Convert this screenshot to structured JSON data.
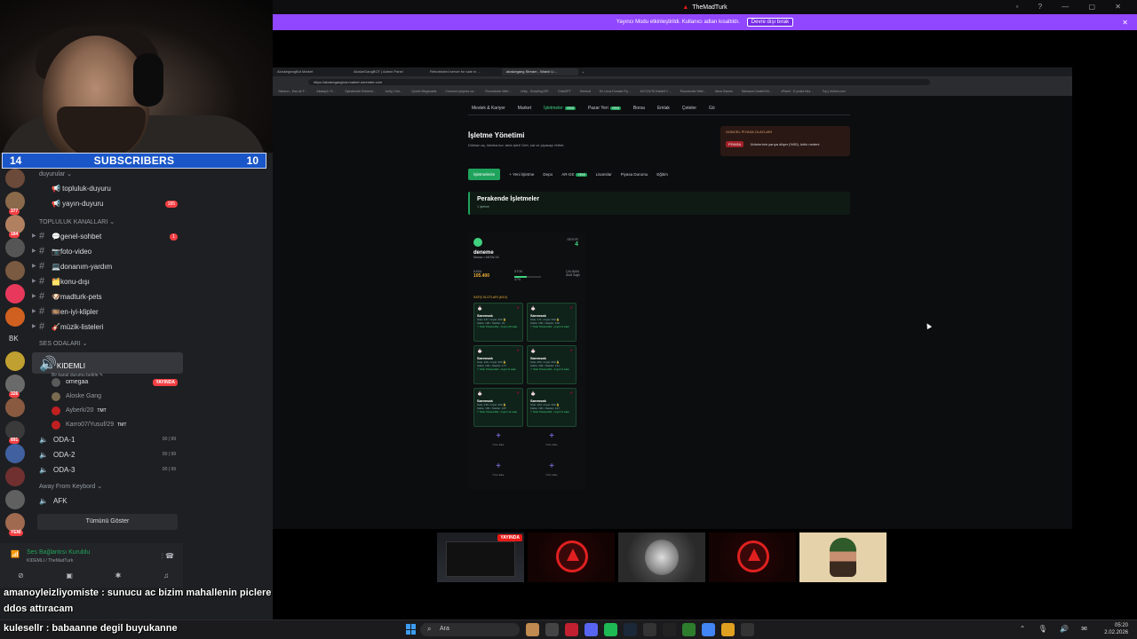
{
  "subscribers_bar": {
    "left": "14",
    "title": "SUBSCRIBERS",
    "right": "10"
  },
  "discord": {
    "guild_badges": [
      "377",
      "184",
      "326",
      "891"
    ],
    "bk_label": "BK",
    "new_label": "YENİ",
    "categories": {
      "duyurular": "duyurular ⌄",
      "topluluk": "TOPLULUK KANALLARI ⌄",
      "ses": "SES ODALARI ⌄",
      "afk": "Away From Keybord ⌄"
    },
    "top_channels": [
      {
        "name": "📢 topluluk-duyuru",
        "count": ""
      },
      {
        "name": "📢 yayın-duyuru",
        "count": "185"
      }
    ],
    "text_channels": [
      {
        "name": "💬genel-sohbet",
        "count": "1"
      },
      {
        "name": "📷foto-video",
        "count": ""
      },
      {
        "name": "💻donanım-yardım",
        "count": ""
      },
      {
        "name": "🗂️konu-dışı",
        "count": ""
      },
      {
        "name": "🐶madturk-pets",
        "count": ""
      },
      {
        "name": "🎞️en-iyi-klipler",
        "count": ""
      },
      {
        "name": "🎸müzik-listeleri",
        "count": ""
      }
    ],
    "active_voice": {
      "name": "KIDEMLI",
      "status": "Bir kanal durumu belirle ✎"
    },
    "voice_users": [
      {
        "name": "omegaa",
        "badge": "YAYINDA",
        "tag": ""
      },
      {
        "name": "Aloske Gang",
        "badge": "",
        "tag": ""
      },
      {
        "name": "Ayberk/20",
        "badge": "",
        "tag": "TMT"
      },
      {
        "name": "Karro07/Yusuf/29",
        "badge": "",
        "tag": "TMT"
      }
    ],
    "rooms": [
      {
        "name": "ODA-1",
        "count": "00 | 99"
      },
      {
        "name": "ODA-2",
        "count": "00 | 99"
      },
      {
        "name": "ODA-3",
        "count": "00 | 99"
      }
    ],
    "afk_room": "AFK",
    "show_all": "Tümünü Göster",
    "user_panel": {
      "status": "Ses Bağlantısı Kuruldu",
      "sub": "KIDEMLI / TheMadTurk"
    }
  },
  "twitch": {
    "window_title": "TheMadTurk",
    "banner_text": "Yayıncı Modu etkinleştirildi. Kullanıcı adları kısaltıldı.",
    "banner_button": "Devre dışı bırak"
  },
  "browser": {
    "tabs": [
      "AloskegangBot Market",
      "AloskeGangBOT | Admin Panel",
      "Refurbished server for sale in …",
      "aloskegang Stream - Watch Li…"
    ],
    "url": "https://aloskegangbot-market.onrender.com",
    "bookmarks": [
      "Yabancı - Eau de F…",
      "Akasaylı / E…",
      "Spinakorde Extreme…",
      "Unity | Kar…",
      "Quizet Megacasts",
      "Common physics ca…",
      "Roundcube Web…",
      "Unity - Scripting API:",
      "ChatGPT",
      "General",
      "En Ucuz Domain Fiy…",
      "ACCOUTA Kalabit Y…",
      "Roundcube Web…",
      "Itaca Games",
      "Mancara Casket Bü…",
      "cPanel - E-posta Hes…",
      "Top | dollurs.com"
    ]
  },
  "site": {
    "nav": [
      {
        "label": "Meslek & Kariyer",
        "active": false,
        "new": ""
      },
      {
        "label": "Market",
        "active": false,
        "new": ""
      },
      {
        "label": "İşletmeler",
        "active": true,
        "new": "YENİ"
      },
      {
        "label": "Pazar Yeri",
        "active": false,
        "new": "YENİ"
      },
      {
        "label": "Borsa",
        "active": false,
        "new": ""
      },
      {
        "label": "Emlak",
        "active": false,
        "new": ""
      },
      {
        "label": "Çeteler",
        "active": false,
        "new": ""
      },
      {
        "label": "Gö",
        "active": false,
        "new": ""
      }
    ],
    "page_title": "İşletme Yönetimi",
    "page_desc": "Dükkan aç, fabrika kur, tarla işlet! Üret, sat ve piyasayı fethet.",
    "market_title": "GÜNCEL PİYASA OLAYLARI",
    "market_tag": "PİYASA",
    "market_text": "Ürünlerinin yarıya düşer (%50), kıtlık nedeni",
    "actions": [
      "İşletmelerim",
      "+ Yeni İşletme",
      "Depo",
      "AR-GE",
      "Lisanslar",
      "Piyasa Durumu",
      "Eğitim"
    ],
    "actions_new_tag": "YENİ",
    "section_title": "Perakende İşletmeler",
    "section_sub": "1 işletme",
    "business": {
      "level_label": "SEVİYE",
      "level": "4",
      "name": "deneme",
      "location": "Manav • ANTALYA",
      "kasa_label": "KASA",
      "kasa_value": "105.400",
      "stok_label": "STOK",
      "stok_value": "47%",
      "stok_level": 0.47,
      "calisan_label": "ÇALIŞAN",
      "calisan_value": "Atölf Sağlı",
      "slots_title": "SATIŞ SLOTLARI (6/10)",
      "slots": [
        {
          "name": "Sarımsak",
          "l1": "Stok: 247 • Fiyat: 200 🔒",
          "l2": "Kalite: 100 • Satılan: 20",
          "l3": "⚡ Stok Tükenebilir ~5 gün 20 saat"
        },
        {
          "name": "Sarımsak",
          "l1": "Stok: 171 • Fiyat: 200 🔒",
          "l2": "Kalite: 100 • Satılan: 160",
          "l3": "⚡ Stok Tükenebilir ~3 gün 6 saat"
        },
        {
          "name": "Sarımsak",
          "l1": "Stok: 226 • Fiyat: 200 🔒",
          "l2": "Kalite: 100 • Satılan: 177",
          "l3": "⚡ Stok Tükenebilir ~3 gün 0 saat"
        },
        {
          "name": "Sarımsak",
          "l1": "Stok: 253 • Fiyat: 200 🔒",
          "l2": "Kalite: 100 • Satılan: 141",
          "l3": "⚡ Stok Tükenebilir ~2 gün 6 saat"
        },
        {
          "name": "Sarımsak",
          "l1": "Stok: 218 • Fiyat: 200 🔒",
          "l2": "Kalite: 100 • Satılan: 107",
          "l3": "⚡ Stok Tükenebilir ~3 gün 11 saat"
        },
        {
          "name": "Sarımsak",
          "l1": "Stok: 103 • Fiyat: 200 🔒",
          "l2": "Kalite: 100 • Satılan: 147",
          "l3": "⚡ Stok Tükenebilir ~3 gün 0 saat"
        }
      ],
      "add_label": "Ürün Ekle"
    }
  },
  "thumbs": {
    "live_label": "YAYINDA"
  },
  "chat": [
    {
      "user": "amanoyleizliyomiste",
      "msg": ": sunucu ac bizim mahallenin piclere"
    },
    {
      "user": "",
      "msg": "ddos attıracam"
    },
    {
      "user": "kulesellr",
      "msg": ": babaanne degil buyukanne"
    }
  ],
  "taskbar": {
    "search": "Ara",
    "time": "05:20",
    "date": "2.02.2026"
  }
}
